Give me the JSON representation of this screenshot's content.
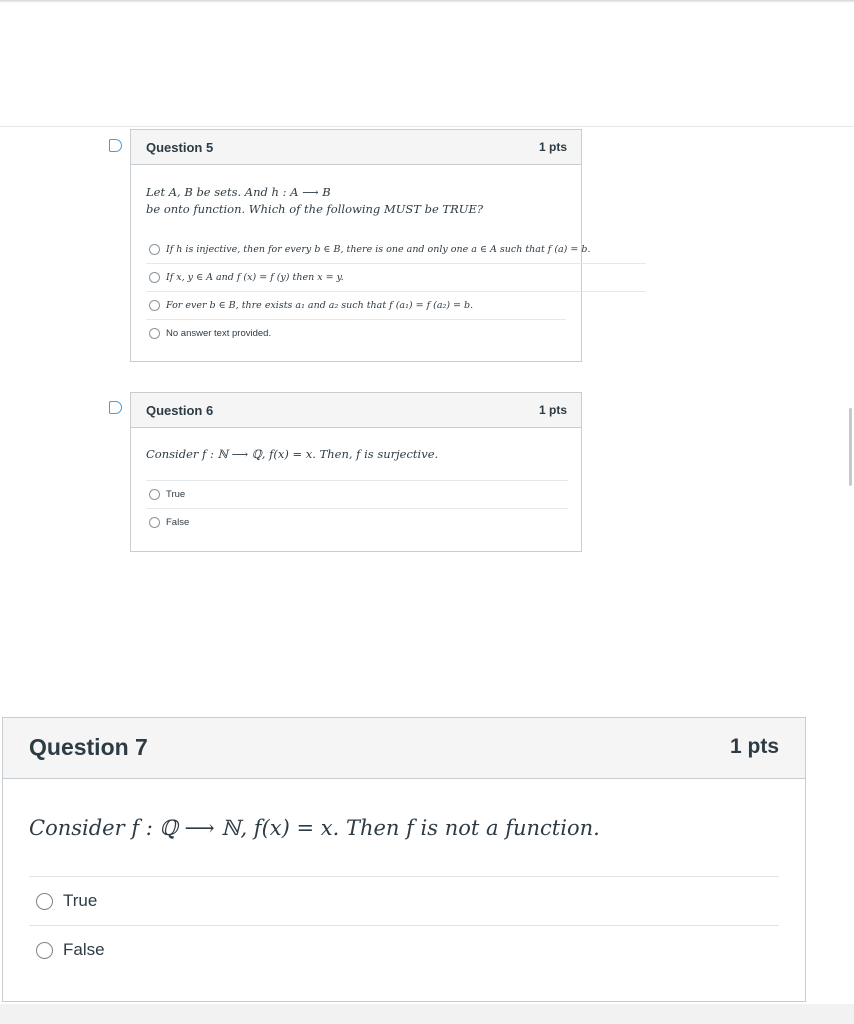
{
  "q5": {
    "title": "Question 5",
    "points": "1 pts",
    "text_line1": "Let A, B be sets. And h : A ⟶ B",
    "text_line2": "be onto function. Which of the following MUST be TRUE?",
    "answers": [
      "If h is injective, then for every b ∈ B, there is one and only one a ∈ A such that f (a) = b.",
      "If x, y ∈ A and f (x) = f (y) then x = y.",
      "For ever b ∈ B, thre exists a₁ and a₂ such that f (a₁) = f (a₂) = b.",
      "No answer text provided."
    ]
  },
  "q6": {
    "title": "Question 6",
    "points": "1 pts",
    "text": "Consider f : ℕ ⟶ ℚ, f(x) = x. Then, f is surjective.",
    "answers": [
      "True",
      "False"
    ]
  },
  "q7": {
    "title": "Question 7",
    "points": "1 pts",
    "text": "Consider f : ℚ ⟶ ℕ, f(x) = x. Then f is not a function.",
    "answers": [
      "True",
      "False"
    ]
  },
  "icons": {
    "flag": "flag-icon",
    "radio": "radio-button-icon"
  },
  "colors": {
    "flag": "#4a9bd6",
    "header_bg": "#f5f5f5",
    "border": "#c7cdd1"
  }
}
